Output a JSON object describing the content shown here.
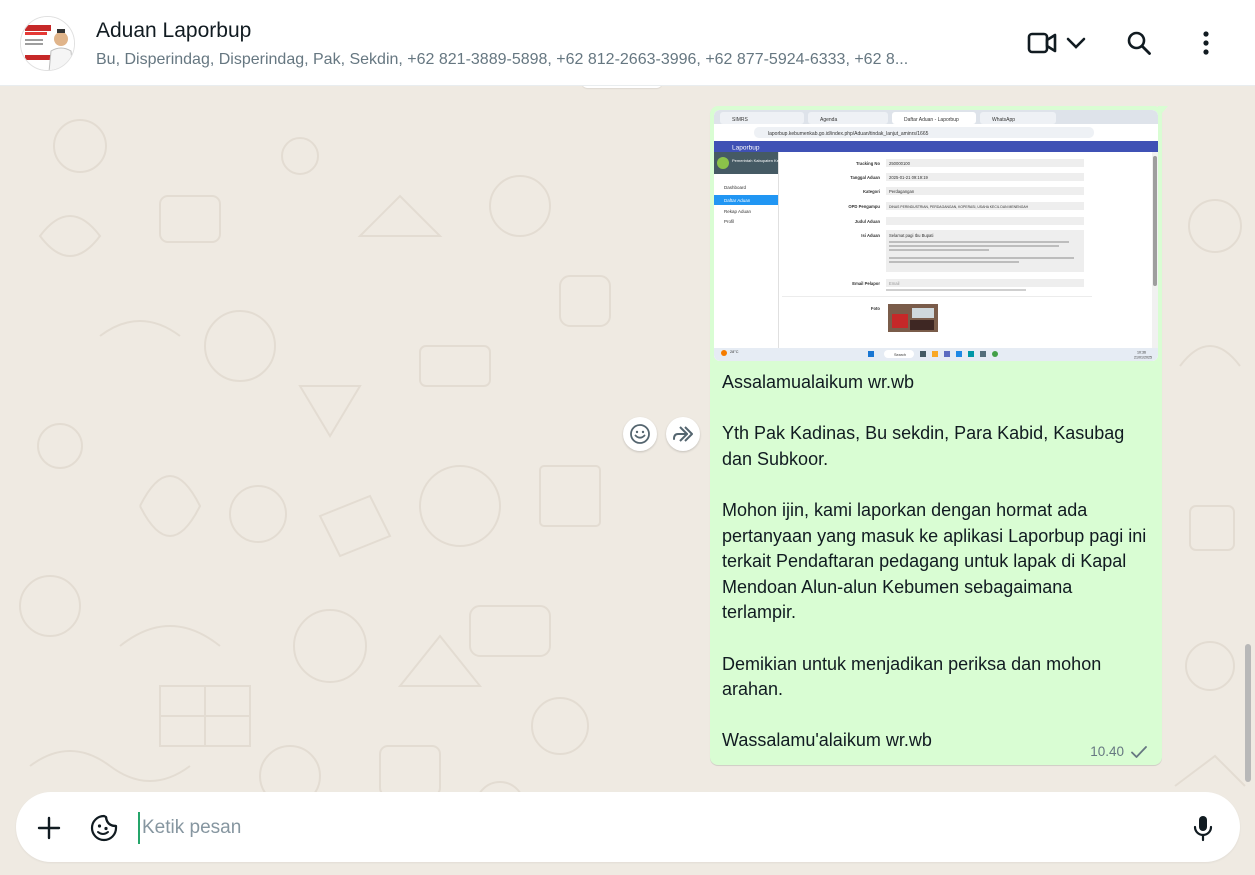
{
  "header": {
    "title": "Aduan Laporbup",
    "members": "Bu, Disperindag, Disperindag, Pak, Sekdin, +62 821-3889-5898, +62 812-2663-3996, +62 877-5924-6333, +62 8...",
    "avatar_icon": "group-avatar-icon",
    "video_icon": "video-camera-icon",
    "dropdown_icon": "chevron-down-icon",
    "search_icon": "search-icon",
    "menu_icon": "kebab-menu-icon"
  },
  "message": {
    "text": "Assalamualaikum wr.wb\n\nYth Pak Kadinas, Bu sekdin, Para Kabid, Kasubag dan Subkoor.\n\nMohon ijin, kami laporkan dengan hormat ada pertanyaan yang masuk ke aplikasi Laporbup pagi ini terkait Pendaftaran pedagang untuk lapak di Kapal Mendoan Alun-alun Kebumen sebagaimana terlampir.\n\nDemikian untuk menjadikan periksa dan mohon arahan.\n\nWassalamu'alaikum wr.wb",
    "time": "10.40",
    "status_icon": "single-check-icon",
    "bubble_color": "#d9fdd3",
    "attachment": {
      "browser_tabs": [
        "SIMRS",
        "Agenda",
        "Daftar Aduan - Laporbup",
        "WhatsApp"
      ],
      "url": "laporbup.kebumenkab.go.id/index.php/Aduan/tindak_lanjut_aminrs/1665",
      "app_name": "Laporbup",
      "org_name": "Pemerintah Kabupaten Kebumen",
      "sidebar_items": [
        "Dashboard",
        "Daftar Aduan",
        "Rekap Aduan",
        "Profil"
      ],
      "form_fields": [
        {
          "label": "Tracking No",
          "value": "250000100"
        },
        {
          "label": "Tanggal Aduan",
          "value": "2025-01-21 09:19:19"
        },
        {
          "label": "Kategori",
          "value": "Perdagangan"
        },
        {
          "label": "OPD Pengampu",
          "value": "DINAS PERINDUSTRIAN, PERDAGANGAN, KOPERASI, USAHA KECIL DAN MENENGAH"
        },
        {
          "label": "Judul Aduan",
          "value": ""
        },
        {
          "label": "Isi Aduan",
          "value": "Selamat pagi Ibu Bupati"
        },
        {
          "label": "Email Pelapor",
          "value": "Email"
        },
        {
          "label": "Foto",
          "value": ""
        }
      ],
      "taskbar_search": "Search",
      "taskbar_weather": "28°C",
      "taskbar_clock": "10:36",
      "taskbar_date": "21/01/2025"
    }
  },
  "actions": {
    "react_icon": "emoji-smile-icon",
    "forward_icon": "forward-icon"
  },
  "composer": {
    "placeholder": "Ketik pesan",
    "attach_icon": "plus-icon",
    "sticker_icon": "sticker-icon",
    "mic_icon": "microphone-icon"
  },
  "colors": {
    "background": "#efeae2",
    "header": "#ffffff",
    "outgoing_bubble": "#d9fdd3",
    "muted_text": "#667781"
  }
}
